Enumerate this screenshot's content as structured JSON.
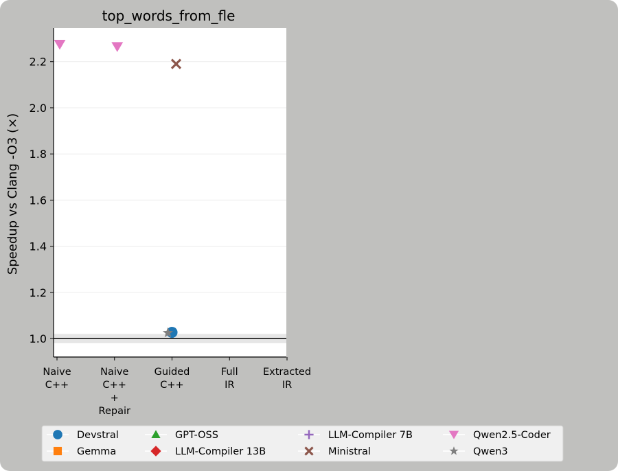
{
  "chart_data": {
    "type": "scatter",
    "title": "top_words_from_fle",
    "xlabel": "",
    "ylabel": "Speedup vs Clang -O3 (×)",
    "categories": [
      [
        "Naive",
        "C++"
      ],
      [
        "Naive",
        "C++",
        "+",
        "Repair"
      ],
      [
        "Guided",
        "C++"
      ],
      [
        "Full",
        "IR"
      ],
      [
        "Extracted",
        "IR"
      ]
    ],
    "ylim": [
      0.92,
      2.345
    ],
    "yticks": [
      1.0,
      1.2,
      1.4,
      1.6,
      1.8,
      2.0,
      2.2
    ],
    "ytick_labels": [
      "1.0",
      "1.2",
      "1.4",
      "1.6",
      "1.8",
      "2.0",
      "2.2"
    ],
    "grid": "horizontal",
    "reference_line": 1.0,
    "reference_band": [
      0.98,
      1.02
    ],
    "legend_position": "bottom",
    "series": [
      {
        "name": "Devstral",
        "color": "#1f77b4",
        "marker": "circle",
        "points": [
          {
            "x": 2,
            "y": 1.027
          }
        ]
      },
      {
        "name": "Gemma",
        "color": "#ff7f0e",
        "marker": "square",
        "points": []
      },
      {
        "name": "GPT-OSS",
        "color": "#2ca02c",
        "marker": "triangle-up",
        "points": []
      },
      {
        "name": "LLM-Compiler 13B",
        "color": "#d62728",
        "marker": "diamond",
        "points": []
      },
      {
        "name": "LLM-Compiler 7B",
        "color": "#9467bd",
        "marker": "plus",
        "points": []
      },
      {
        "name": "Ministral",
        "color": "#8c564b",
        "marker": "x",
        "points": [
          {
            "x": 2,
            "y": 2.19
          }
        ]
      },
      {
        "name": "Qwen2.5-Coder",
        "color": "#e377c2",
        "marker": "triangle-down",
        "points": [
          {
            "x": 0,
            "y": 2.275
          },
          {
            "x": 1,
            "y": 2.265
          }
        ]
      },
      {
        "name": "Qwen3",
        "color": "#7f7f7f",
        "marker": "star",
        "points": [
          {
            "x": 2,
            "y": 1.025
          }
        ]
      }
    ]
  }
}
